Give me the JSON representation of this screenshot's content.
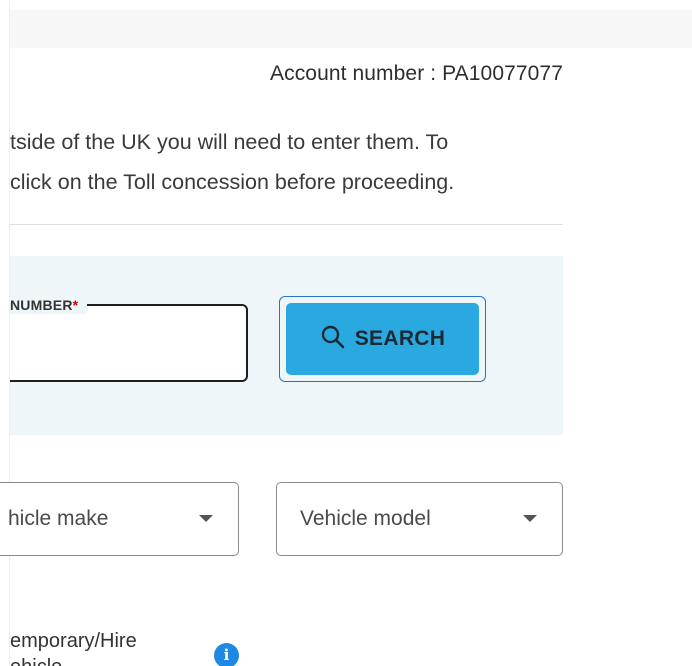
{
  "header": {
    "account_label": "Account number : PA10077077"
  },
  "intro": {
    "line1": "tside of the UK you will need to enter them. To",
    "line2": " click on the Toll concession before proceeding."
  },
  "search_panel": {
    "reg_label": "NUMBER",
    "required_mark": "*",
    "reg_value": "",
    "search_button_label": "SEARCH"
  },
  "vehicle": {
    "make_value": "hicle make",
    "model_value": "Vehicle model"
  },
  "temp_vehicle": {
    "line1": "emporary/Hire",
    "line2": "ehicle"
  },
  "icons": {
    "search": "search-icon",
    "dropdown": "chevron-down-icon",
    "info": "info-icon"
  },
  "colors": {
    "search_button": "#2aa8e0",
    "panel_background": "#eef6fa",
    "focus_outline": "#2a72c8",
    "required": "#d10000",
    "info": "#1e88e5"
  }
}
